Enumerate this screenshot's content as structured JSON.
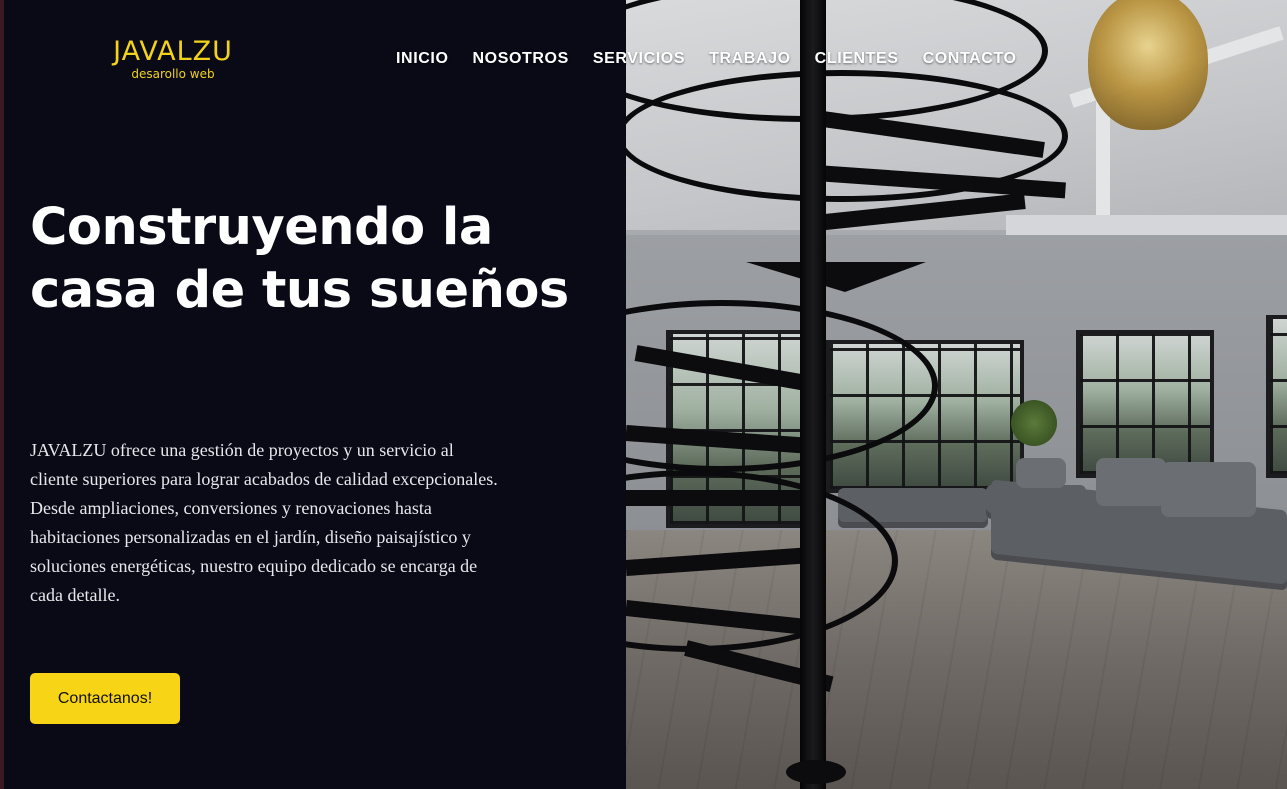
{
  "brand": {
    "name": "JAVALZU",
    "tagline": "desarollo web",
    "accent_color": "#f2d21b"
  },
  "nav": {
    "items": [
      {
        "label": "INICIO"
      },
      {
        "label": "NOSOTROS"
      },
      {
        "label": "SERVICIOS"
      },
      {
        "label": "TRABAJO"
      },
      {
        "label": "CLIENTES"
      },
      {
        "label": "CONTACTO"
      }
    ]
  },
  "hero": {
    "title": "Construyendo la casa de tus sueños",
    "description": "JAVALZU ofrece una gestión de proyectos y un servicio al cliente superiores para lograr acabados de calidad excepcionales. Desde ampliaciones, conversiones y renovaciones hasta habitaciones personalizadas en el jardín, diseño paisajístico y soluciones energéticas, nuestro equipo dedicado se encarga de cada detalle.",
    "cta_label": "Contactanos!",
    "cta_color": "#f7d516",
    "background_color": "#0a0a17"
  },
  "image": {
    "subject": "interior-spiral-staircase-living-room"
  }
}
